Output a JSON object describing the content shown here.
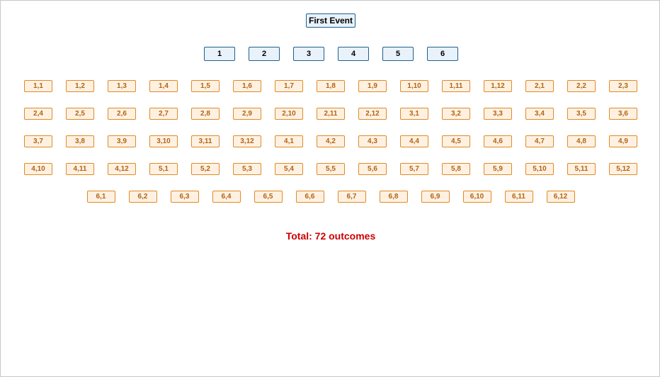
{
  "diagram": {
    "root": {
      "label": "First Event"
    },
    "first_outcomes": [
      "1",
      "2",
      "3",
      "4",
      "5",
      "6"
    ],
    "outcome_rows": [
      [
        "1,1",
        "1,2",
        "1,3",
        "1,4",
        "1,5",
        "1,6",
        "1,7",
        "1,8",
        "1,9",
        "1,10",
        "1,11",
        "1,12",
        "2,1",
        "2,2",
        "2,3"
      ],
      [
        "2,4",
        "2,5",
        "2,6",
        "2,7",
        "2,8",
        "2,9",
        "2,10",
        "2,11",
        "2,12",
        "3,1",
        "3,2",
        "3,3",
        "3,4",
        "3,5",
        "3,6"
      ],
      [
        "3,7",
        "3,8",
        "3,9",
        "3,10",
        "3,11",
        "3,12",
        "4,1",
        "4,2",
        "4,3",
        "4,4",
        "4,5",
        "4,6",
        "4,7",
        "4,8",
        "4,9"
      ],
      [
        "4,10",
        "4,11",
        "4,12",
        "5,1",
        "5,2",
        "5,3",
        "5,4",
        "5,5",
        "5,6",
        "5,7",
        "5,8",
        "5,9",
        "5,10",
        "5,11",
        "5,12"
      ],
      [
        "6,1",
        "6,2",
        "6,3",
        "6,4",
        "6,5",
        "6,6",
        "6,7",
        "6,8",
        "6,9",
        "6,10",
        "6,11",
        "6,12"
      ]
    ],
    "total_label": "Total: 72 outcomes"
  },
  "colors": {
    "event_fill": "#e8f2fb",
    "event_border": "#1f5f8f",
    "outcome_fill": "#fff1e2",
    "outcome_border": "#e08a24",
    "outcome_text": "#b36412",
    "total_text": "#cc0000"
  }
}
